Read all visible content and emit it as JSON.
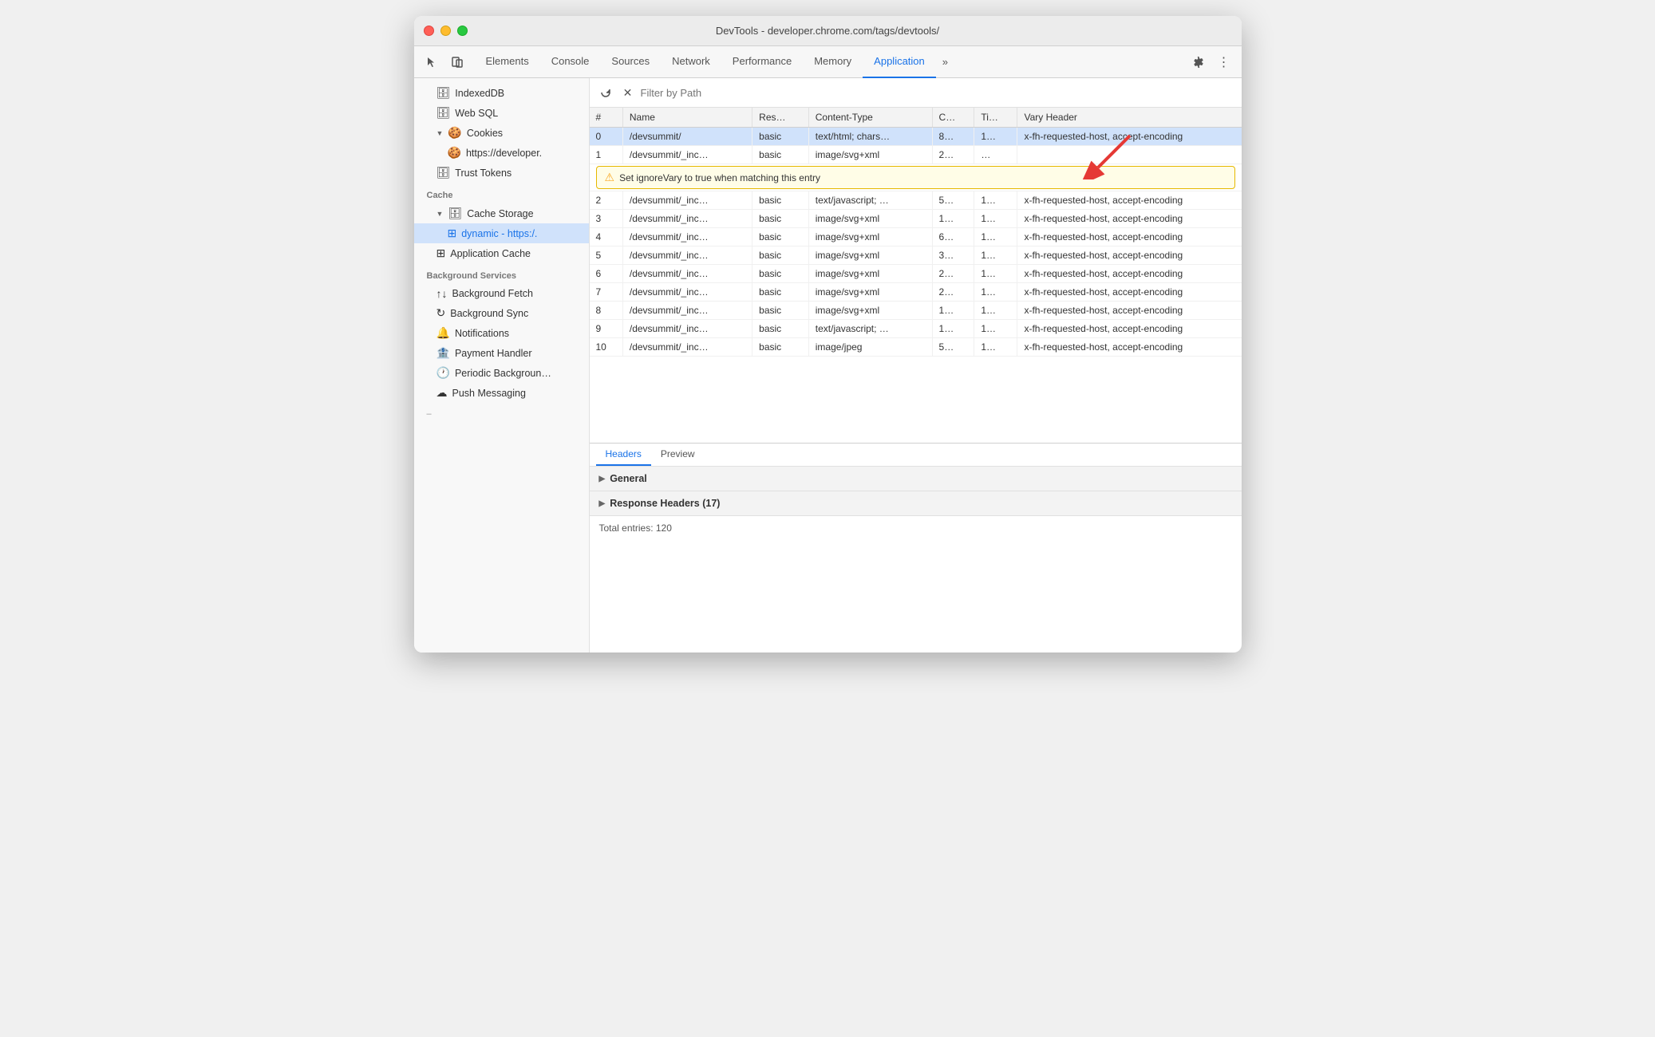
{
  "window": {
    "title": "DevTools - developer.chrome.com/tags/devtools/"
  },
  "tabs": [
    {
      "id": "elements",
      "label": "Elements",
      "active": false
    },
    {
      "id": "console",
      "label": "Console",
      "active": false
    },
    {
      "id": "sources",
      "label": "Sources",
      "active": false
    },
    {
      "id": "network",
      "label": "Network",
      "active": false
    },
    {
      "id": "performance",
      "label": "Performance",
      "active": false
    },
    {
      "id": "memory",
      "label": "Memory",
      "active": false
    },
    {
      "id": "application",
      "label": "Application",
      "active": true
    }
  ],
  "sidebar": {
    "items": [
      {
        "id": "indexeddb",
        "label": "IndexedDB",
        "indent": 1,
        "icon": "🗄",
        "hasArrow": false
      },
      {
        "id": "websql",
        "label": "Web SQL",
        "indent": 1,
        "icon": "🗄",
        "hasArrow": false
      },
      {
        "id": "cookies",
        "label": "Cookies",
        "indent": 1,
        "icon": "🍪",
        "hasArrow": true,
        "expanded": true
      },
      {
        "id": "cookies-https",
        "label": "https://developer.",
        "indent": 2,
        "icon": "🍪",
        "hasArrow": false
      },
      {
        "id": "trust-tokens",
        "label": "Trust Tokens",
        "indent": 1,
        "icon": "🗄",
        "hasArrow": false
      }
    ],
    "cache_section": "Cache",
    "cache_items": [
      {
        "id": "cache-storage",
        "label": "Cache Storage",
        "indent": 1,
        "icon": "🗄",
        "hasArrow": true,
        "expanded": true
      },
      {
        "id": "dynamic",
        "label": "dynamic - https:/.",
        "indent": 2,
        "icon": "⊞",
        "hasArrow": false,
        "selected": true
      },
      {
        "id": "app-cache",
        "label": "Application Cache",
        "indent": 1,
        "icon": "⊞",
        "hasArrow": false
      }
    ],
    "bg_section": "Background Services",
    "bg_items": [
      {
        "id": "bg-fetch",
        "label": "Background Fetch",
        "indent": 1,
        "icon": "↑↓"
      },
      {
        "id": "bg-sync",
        "label": "Background Sync",
        "indent": 1,
        "icon": "↻"
      },
      {
        "id": "notifications",
        "label": "Notifications",
        "indent": 1,
        "icon": "🔔"
      },
      {
        "id": "payment-handler",
        "label": "Payment Handler",
        "indent": 1,
        "icon": "🏦"
      },
      {
        "id": "periodic-bg",
        "label": "Periodic Backgroun…",
        "indent": 1,
        "icon": "🕐"
      },
      {
        "id": "push-messaging",
        "label": "Push Messaging",
        "indent": 1,
        "icon": "☁"
      }
    ]
  },
  "filter": {
    "placeholder": "Filter by Path"
  },
  "table": {
    "columns": [
      "#",
      "Name",
      "Res…",
      "Content-Type",
      "C…",
      "Ti…",
      "Vary Header"
    ],
    "rows": [
      {
        "num": "0",
        "name": "/devsummit/",
        "res": "basic",
        "content_type": "text/html; chars…",
        "c": "8…",
        "ti": "1…",
        "vary": "x-fh-requested-host, accept-encoding",
        "selected": true
      },
      {
        "num": "1",
        "name": "/devsummit/_inc…",
        "res": "basic",
        "content_type": "image/svg+xml",
        "c": "2…",
        "ti": "…",
        "vary": "",
        "tooltip": true
      },
      {
        "num": "2",
        "name": "/devsummit/_inc…",
        "res": "basic",
        "content_type": "text/javascript; …",
        "c": "5…",
        "ti": "1…",
        "vary": "x-fh-requested-host, accept-encoding"
      },
      {
        "num": "3",
        "name": "/devsummit/_inc…",
        "res": "basic",
        "content_type": "image/svg+xml",
        "c": "1…",
        "ti": "1…",
        "vary": "x-fh-requested-host, accept-encoding"
      },
      {
        "num": "4",
        "name": "/devsummit/_inc…",
        "res": "basic",
        "content_type": "image/svg+xml",
        "c": "6…",
        "ti": "1…",
        "vary": "x-fh-requested-host, accept-encoding"
      },
      {
        "num": "5",
        "name": "/devsummit/_inc…",
        "res": "basic",
        "content_type": "image/svg+xml",
        "c": "3…",
        "ti": "1…",
        "vary": "x-fh-requested-host, accept-encoding"
      },
      {
        "num": "6",
        "name": "/devsummit/_inc…",
        "res": "basic",
        "content_type": "image/svg+xml",
        "c": "2…",
        "ti": "1…",
        "vary": "x-fh-requested-host, accept-encoding"
      },
      {
        "num": "7",
        "name": "/devsummit/_inc…",
        "res": "basic",
        "content_type": "image/svg+xml",
        "c": "2…",
        "ti": "1…",
        "vary": "x-fh-requested-host, accept-encoding"
      },
      {
        "num": "8",
        "name": "/devsummit/_inc…",
        "res": "basic",
        "content_type": "image/svg+xml",
        "c": "1…",
        "ti": "1…",
        "vary": "x-fh-requested-host, accept-encoding"
      },
      {
        "num": "9",
        "name": "/devsummit/_inc…",
        "res": "basic",
        "content_type": "text/javascript; …",
        "c": "1…",
        "ti": "1…",
        "vary": "x-fh-requested-host, accept-encoding"
      },
      {
        "num": "10",
        "name": "/devsummit/_inc…",
        "res": "basic",
        "content_type": "image/jpeg",
        "c": "5…",
        "ti": "1…",
        "vary": "x-fh-requested-host, accept-encoding"
      }
    ],
    "tooltip_text": "Set ignoreVary to true when matching this entry"
  },
  "bottom_panel": {
    "tabs": [
      {
        "id": "headers",
        "label": "Headers",
        "active": true
      },
      {
        "id": "preview",
        "label": "Preview",
        "active": false
      }
    ],
    "sections": [
      {
        "id": "general",
        "label": "General"
      },
      {
        "id": "response-headers",
        "label": "Response Headers (17)"
      }
    ],
    "total_entries": "Total entries: 120"
  },
  "colors": {
    "accent": "#1a73e8",
    "selected_bg": "#d0e2fb",
    "tooltip_bg": "#fffde7",
    "red_arrow": "#e53935"
  }
}
